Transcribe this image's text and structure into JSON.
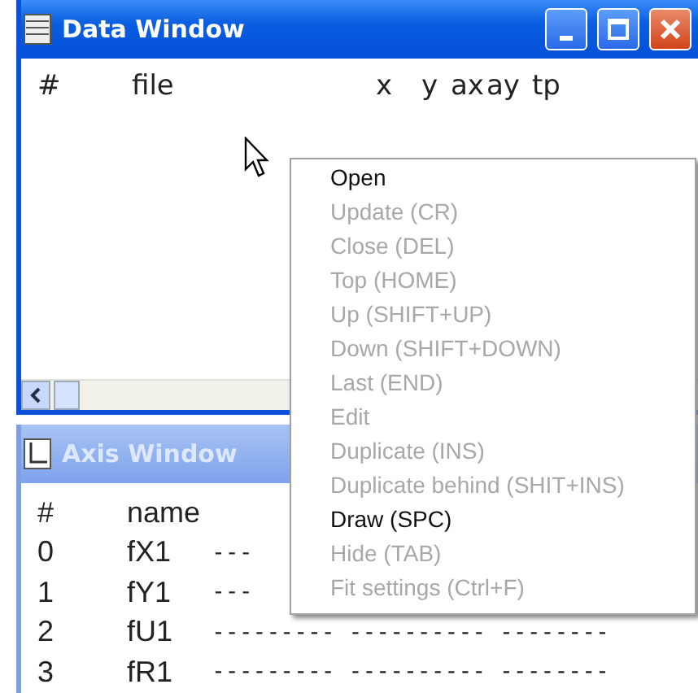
{
  "data_window": {
    "title": "Data Window",
    "columns": [
      "#",
      "file",
      "x",
      "y",
      "ax",
      "ay",
      "tp"
    ]
  },
  "axis_window": {
    "title": "Axis Window",
    "header": [
      "#",
      "name"
    ],
    "rows": [
      {
        "index": "0",
        "name": "fX1",
        "dashes": "---"
      },
      {
        "index": "1",
        "name": "fY1",
        "dashes": "---"
      },
      {
        "index": "2",
        "name": "fU1",
        "dashes": "--------- ---------- --------"
      },
      {
        "index": "3",
        "name": "fR1",
        "dashes": "--------- ---------- --------"
      }
    ]
  },
  "context_menu": {
    "items": [
      {
        "label": "Open",
        "disabled": false
      },
      {
        "label": "Update (CR)",
        "disabled": true
      },
      {
        "label": "Close (DEL)",
        "disabled": true
      },
      {
        "label": "Top (HOME)",
        "disabled": true
      },
      {
        "label": "Up (SHIFT+UP)",
        "disabled": true
      },
      {
        "label": "Down (SHIFT+DOWN)",
        "disabled": true
      },
      {
        "label": "Last (END)",
        "disabled": true
      },
      {
        "label": "Edit",
        "disabled": true
      },
      {
        "label": "Duplicate (INS)",
        "disabled": true
      },
      {
        "label": "Duplicate behind (SHIT+INS)",
        "disabled": true
      },
      {
        "label": "Draw (SPC)",
        "disabled": false
      },
      {
        "label": "Hide (TAB)",
        "disabled": true
      },
      {
        "label": "Fit settings (Ctrl+F)",
        "disabled": true
      }
    ]
  }
}
